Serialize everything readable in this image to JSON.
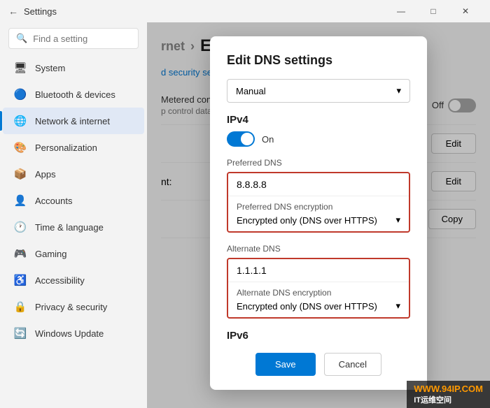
{
  "window": {
    "title": "Settings",
    "controls": {
      "minimize": "—",
      "maximize": "□",
      "close": "✕"
    }
  },
  "sidebar": {
    "search_placeholder": "Find a setting",
    "items": [
      {
        "id": "system",
        "label": "System",
        "icon": "🖥",
        "active": false
      },
      {
        "id": "bluetooth",
        "label": "Bluetooth & devices",
        "icon": "🔵",
        "active": false
      },
      {
        "id": "network",
        "label": "Network & internet",
        "icon": "🌐",
        "active": true
      },
      {
        "id": "personalization",
        "label": "Personalization",
        "icon": "🎨",
        "active": false
      },
      {
        "id": "apps",
        "label": "Apps",
        "icon": "📦",
        "active": false
      },
      {
        "id": "accounts",
        "label": "Accounts",
        "icon": "👤",
        "active": false
      },
      {
        "id": "time",
        "label": "Time & language",
        "icon": "🕐",
        "active": false
      },
      {
        "id": "gaming",
        "label": "Gaming",
        "icon": "🎮",
        "active": false
      },
      {
        "id": "accessibility",
        "label": "Accessibility",
        "icon": "♿",
        "active": false
      },
      {
        "id": "privacy",
        "label": "Privacy & security",
        "icon": "🔒",
        "active": false
      },
      {
        "id": "update",
        "label": "Windows Update",
        "icon": "🔄",
        "active": false
      }
    ]
  },
  "right_panel": {
    "breadcrumb_prefix": "rnet",
    "breadcrumb_arrow": "›",
    "breadcrumb_current": "Ethernet",
    "security_link": "d security settings",
    "metered_label": "Metered connection",
    "metered_desc": "p control data usage on thi...",
    "toggle_off_label": "Off",
    "edit_label_1": "Edit",
    "edit_label_2": "Edit",
    "copy_label": "Copy",
    "nt_label": "nt:"
  },
  "modal": {
    "title": "Edit DNS settings",
    "dropdown_value": "Manual",
    "dropdown_icon": "▾",
    "ipv4_section": "IPv4",
    "toggle_on_label": "On",
    "preferred_dns_label": "Preferred DNS",
    "preferred_dns_value": "8.8.8.8",
    "preferred_encryption_label": "Preferred DNS encryption",
    "preferred_encryption_value": "Encrypted only (DNS over HTTPS)",
    "preferred_encryption_icon": "▾",
    "alternate_dns_label": "Alternate DNS",
    "alternate_dns_value": "1.1.1.1",
    "alternate_encryption_label": "Alternate DNS encryption",
    "alternate_encryption_value": "Encrypted only (DNS over HTTPS)",
    "alternate_encryption_icon": "▾",
    "ipv6_section": "IPv6",
    "save_btn": "Save",
    "cancel_btn": "Cancel"
  },
  "watermark": {
    "line1": "WWW.94IP.COM",
    "line2": "IT运维空间"
  }
}
